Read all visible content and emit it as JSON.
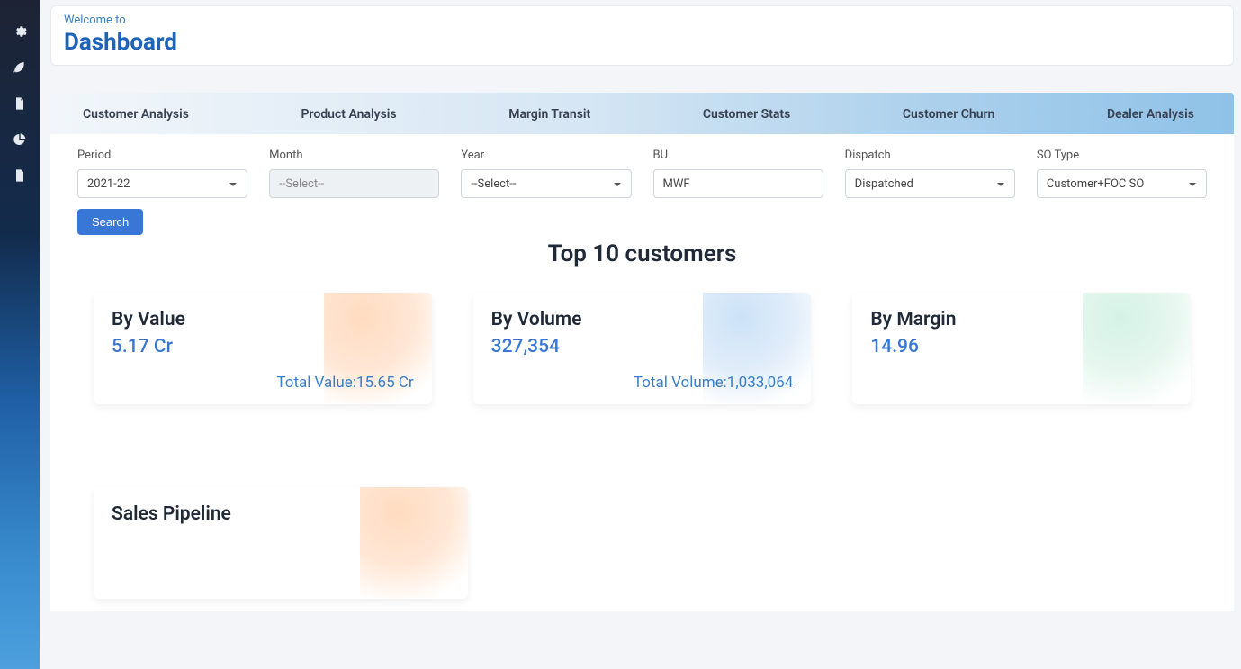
{
  "header": {
    "welcome": "Welcome to",
    "title": "Dashboard"
  },
  "sidebar": {
    "icons": [
      "gear",
      "leaf",
      "file",
      "pie",
      "doc"
    ]
  },
  "tabs": [
    "Customer Analysis",
    "Product Analysis",
    "Margin Transit",
    "Customer Stats",
    "Customer Churn",
    "Dealer Analysis"
  ],
  "filters": {
    "period": {
      "label": "Period",
      "value": "2021-22"
    },
    "month": {
      "label": "Month",
      "value": "--Select--"
    },
    "year": {
      "label": "Year",
      "value": "--Select--"
    },
    "bu": {
      "label": "BU",
      "value": "MWF"
    },
    "dispatch": {
      "label": "Dispatch",
      "value": "Dispatched"
    },
    "sotype": {
      "label": "SO Type",
      "value": "Customer+FOC SO"
    }
  },
  "buttons": {
    "search": "Search"
  },
  "section_title": "Top 10 customers",
  "cards": {
    "value": {
      "title": "By Value",
      "value": "5.17 Cr",
      "total": "Total Value:15.65 Cr"
    },
    "volume": {
      "title": "By Volume",
      "value": "327,354",
      "total": "Total Volume:1,033,064"
    },
    "margin": {
      "title": "By Margin",
      "value": "14.96",
      "total": ""
    }
  },
  "pipeline": {
    "title": "Sales Pipeline"
  }
}
